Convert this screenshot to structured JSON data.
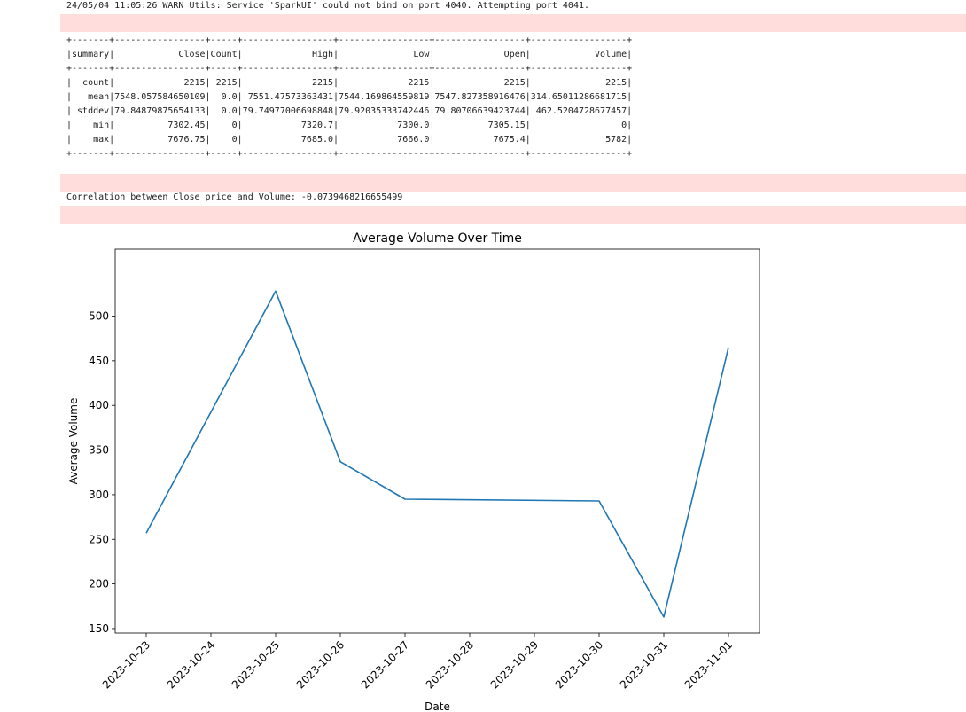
{
  "output": {
    "warn_line": "24/05/04 11:05:26 WARN Utils: Service 'SparkUI' could not bind on port 4040. Attempting port 4041.",
    "table_lines": [
      "+-------+-----------------+-----+-----------------+-----------------+-----------------+------------------+",
      "|summary|            Close|Count|             High|              Low|             Open|            Volume|",
      "+-------+-----------------+-----+-----------------+-----------------+-----------------+------------------+",
      "|  count|             2215| 2215|             2215|             2215|             2215|              2215|",
      "|   mean|7548.057584650109|  0.0| 7551.47573363431|7544.169864559819|7547.827358916476|314.65011286681715|",
      "| stddev|79.84879875654133|  0.0|79.74977006698848|79.92035333742446|79.80706639423744| 462.5204728677457|",
      "|    min|          7302.45|    0|           7320.7|           7300.0|          7305.15|                 0|",
      "|    max|          7676.75|    0|           7685.0|           7666.0|           7675.4|              5782|",
      "+-------+-----------------+-----+-----------------+-----------------+-----------------+------------------+"
    ],
    "correlation_line": "Correlation between Close price and Volume: -0.0739468216655499"
  },
  "chart_data": {
    "type": "line",
    "title": "Average Volume Over Time",
    "xlabel": "Date",
    "ylabel": "Average Volume",
    "categories": [
      "2023-10-23",
      "2023-10-24",
      "2023-10-25",
      "2023-10-26",
      "2023-10-27",
      "2023-10-28",
      "2023-10-29",
      "2023-10-30",
      "2023-10-31",
      "2023-11-01"
    ],
    "series": [
      {
        "x": [
          "2023-10-23",
          "2023-10-25",
          "2023-10-26",
          "2023-10-27",
          "2023-10-30",
          "2023-10-31",
          "2023-11-01"
        ],
        "values": [
          257,
          528,
          337,
          295,
          293,
          163,
          465
        ]
      }
    ],
    "yticks": [
      150,
      200,
      250,
      300,
      350,
      400,
      450,
      500
    ],
    "ylim": [
      145,
      575
    ],
    "grid": false,
    "line_color": "#1f77b4"
  }
}
